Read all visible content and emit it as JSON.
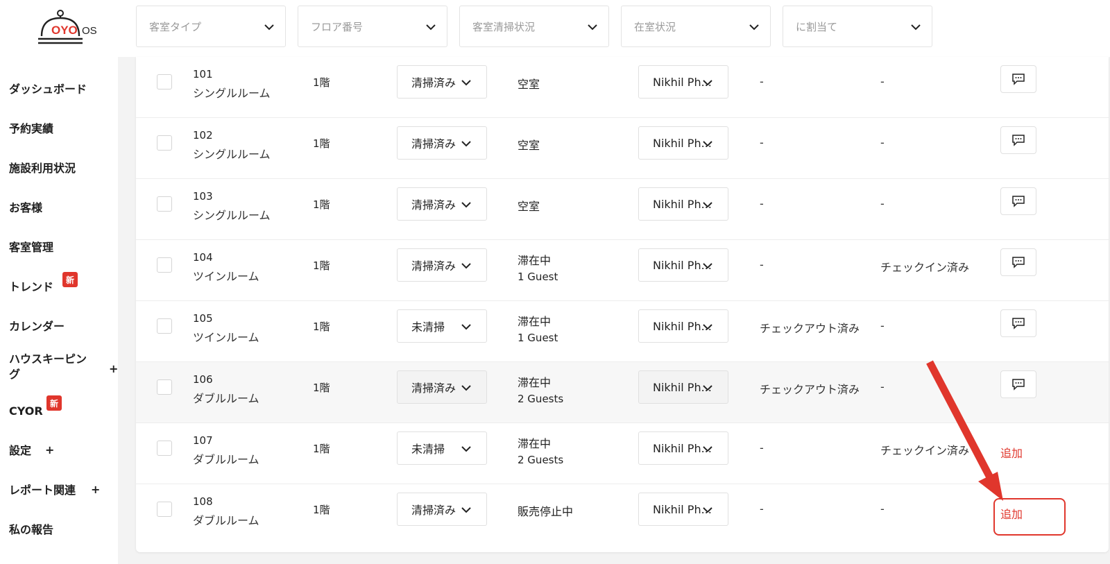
{
  "brand": {
    "logo_text": "OYO",
    "logo_suffix": "OS",
    "accent": "#e0362c"
  },
  "filters": [
    {
      "placeholder": "客室タイプ"
    },
    {
      "placeholder": "フロア番号"
    },
    {
      "placeholder": "客室清掃状況"
    },
    {
      "placeholder": "在室状況"
    },
    {
      "placeholder": "に割当て"
    }
  ],
  "sidebar": {
    "items": [
      {
        "label": "ダッシュボード"
      },
      {
        "label": "予約実績"
      },
      {
        "label": "施設利用状況"
      },
      {
        "label": "お客様"
      },
      {
        "label": "客室管理"
      },
      {
        "label": "トレンド",
        "badge": "新"
      },
      {
        "label": "カレンダー"
      },
      {
        "label": "ハウスキーピング",
        "line1": "ハウスキーピン",
        "line2": "グ",
        "expand": "+"
      },
      {
        "label": "CYOR",
        "badge": "新"
      },
      {
        "label": "設定",
        "expand": "+"
      },
      {
        "label": "レポート関連",
        "expand": "+"
      },
      {
        "label": "私の報告"
      }
    ]
  },
  "rows": [
    {
      "number": "101",
      "type": "シングルルーム",
      "floor": "1階",
      "cleaning": "清掃済み",
      "status": "空室",
      "guests": "",
      "staff": "Nikhil Ph...",
      "checkout": "-",
      "checkin": "-",
      "action": "comment"
    },
    {
      "number": "102",
      "type": "シングルルーム",
      "floor": "1階",
      "cleaning": "清掃済み",
      "status": "空室",
      "guests": "",
      "staff": "Nikhil Ph...",
      "checkout": "-",
      "checkin": "-",
      "action": "comment"
    },
    {
      "number": "103",
      "type": "シングルルーム",
      "floor": "1階",
      "cleaning": "清掃済み",
      "status": "空室",
      "guests": "",
      "staff": "Nikhil Ph...",
      "checkout": "-",
      "checkin": "-",
      "action": "comment"
    },
    {
      "number": "104",
      "type": "ツインルーム",
      "floor": "1階",
      "cleaning": "清掃済み",
      "status": "滞在中",
      "guests": "1 Guest",
      "staff": "Nikhil Ph...",
      "checkout": "-",
      "checkin": "チェックイン済み",
      "action": "comment"
    },
    {
      "number": "105",
      "type": "ツインルーム",
      "floor": "1階",
      "cleaning": "未清掃",
      "status": "滞在中",
      "guests": "1 Guest",
      "staff": "Nikhil Ph...",
      "checkout": "チェックアウト済み",
      "checkin": "-",
      "action": "comment"
    },
    {
      "number": "106",
      "type": "ダブルルーム",
      "floor": "1階",
      "cleaning": "清掃済み",
      "status": "滞在中",
      "guests": "2 Guests",
      "staff": "Nikhil Ph...",
      "checkout": "チェックアウト済み",
      "checkin": "-",
      "action": "comment"
    },
    {
      "number": "107",
      "type": "ダブルルーム",
      "floor": "1階",
      "cleaning": "未清掃",
      "status": "滞在中",
      "guests": "2 Guests",
      "staff": "Nikhil Ph...",
      "checkout": "-",
      "checkin": "チェックイン済み",
      "action": "add",
      "add_label": "追加"
    },
    {
      "number": "108",
      "type": "ダブルルーム",
      "floor": "1階",
      "cleaning": "清掃済み",
      "status": "販売停止中",
      "guests": "",
      "staff": "Nikhil Ph...",
      "checkout": "-",
      "checkin": "-",
      "action": "add",
      "add_label": "追加"
    }
  ],
  "icons": {
    "chevron": "chevron-down-icon",
    "comment": "comment-icon",
    "checkbox": "checkbox",
    "logo": "service-bell-icon"
  }
}
